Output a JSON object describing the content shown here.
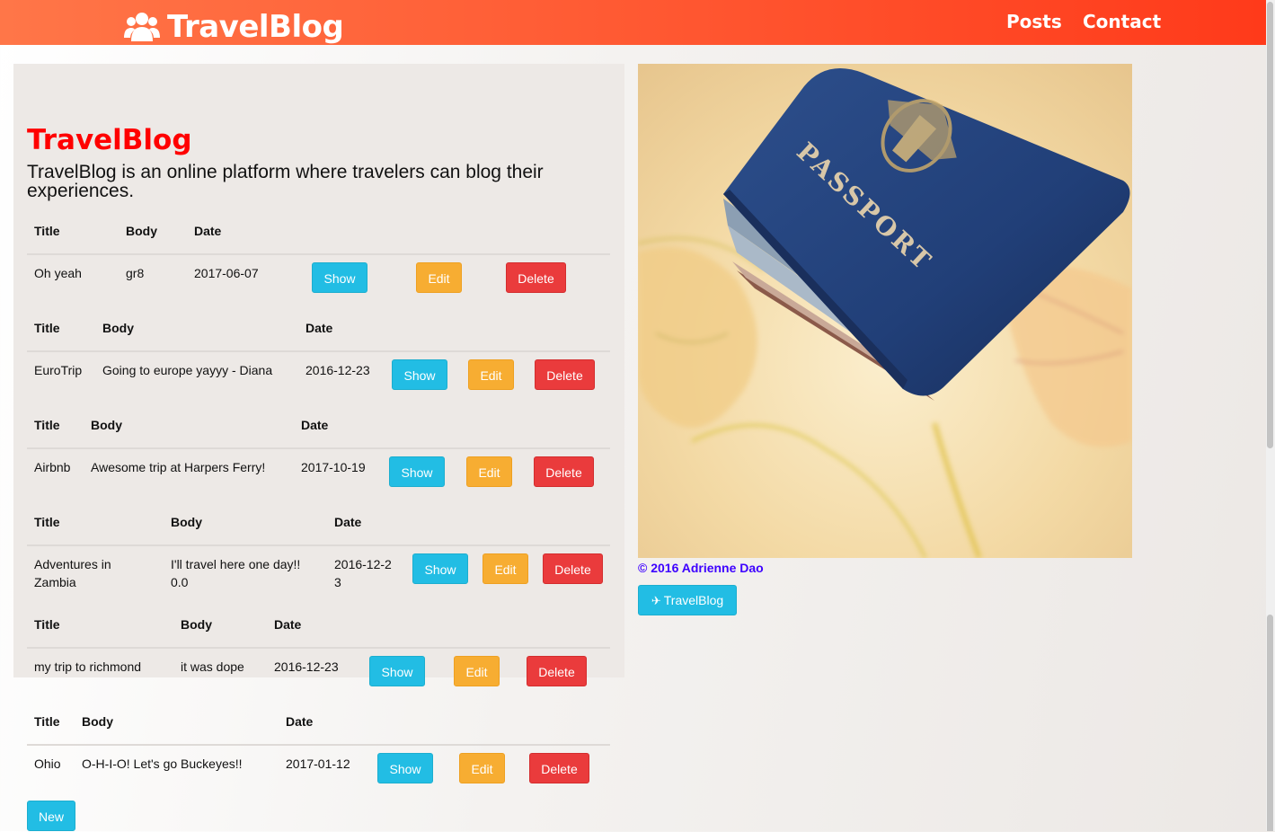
{
  "brand": {
    "name": "TravelBlog",
    "icon": "users-icon"
  },
  "nav": {
    "posts": "Posts",
    "contact": "Contact"
  },
  "jumbotron": {
    "title": "TravelBlog",
    "lead": "TravelBlog is an online platform where travelers can blog their experiences."
  },
  "table_headers": {
    "title": "Title",
    "body": "Body",
    "date": "Date"
  },
  "buttons": {
    "show": "Show",
    "edit": "Edit",
    "delete": "Delete",
    "new": "New"
  },
  "posts": [
    {
      "title": "Oh yeah",
      "body": "gr8",
      "date": "2017-06-07"
    },
    {
      "title": "EuroTrip",
      "body": "Going to europe yayyy - Diana",
      "date": "2016-12-23"
    },
    {
      "title": "Airbnb",
      "body": "Awesome trip at Harpers Ferry!",
      "date": "2017-10-19"
    },
    {
      "title": "Adventures in Zambia",
      "body": "I'll travel here one day!! 0.0",
      "date": "2016-12-23"
    },
    {
      "title": "my trip to richmond",
      "body": "it was dope",
      "date": "2016-12-23"
    },
    {
      "title": "Ohio",
      "body": "O-H-I-O! Let's go Buckeyes!!",
      "date": "2017-01-12"
    }
  ],
  "sidebar": {
    "image_label": "PASSPORT",
    "copyright": "© 2016 Adrienne Dao",
    "button_label": "TravelBlog",
    "button_icon": "plane-icon"
  },
  "colors": {
    "navbar": "#ff5630",
    "title": "#ff0000",
    "show": "#22bde4",
    "edit": "#f7ad32",
    "delete": "#ea3b3c",
    "copyright": "#3d00ff"
  }
}
